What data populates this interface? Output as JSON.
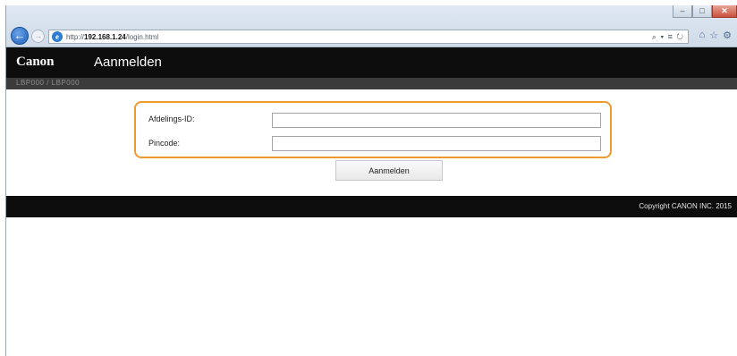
{
  "browser": {
    "url_prefix": "http://",
    "url_host": "192.168.1.24",
    "url_path": "/login.html",
    "address_tools": "⌕ ▾ ≡ ↻",
    "win_minimize": "–",
    "win_maximize": "□",
    "win_close": "✕",
    "back_glyph": "←",
    "forward_glyph": "→",
    "icon_home": "⌂",
    "icon_favorites": "☆",
    "icon_settings": "⚙"
  },
  "header": {
    "brand": "Canon",
    "title": "Aanmelden",
    "subtitle": "LBP000 / LBP000"
  },
  "form": {
    "department_label": "Afdelings-ID:",
    "department_value": "",
    "pin_label": "Pincode:",
    "pin_value": "",
    "submit_label": "Aanmelden"
  },
  "footer": {
    "copyright": "Copyright CANON INC. 2015"
  },
  "colors": {
    "highlight": "#ef9a2e",
    "bar": "#0d0d0d"
  }
}
